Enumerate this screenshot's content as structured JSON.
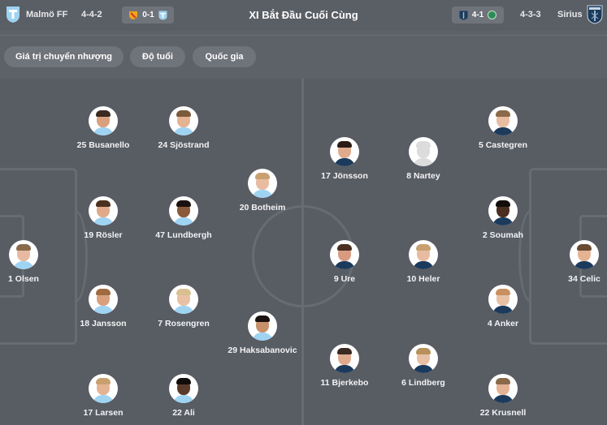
{
  "header": {
    "title": "XI Bắt Đầu Cuối Cùng",
    "home": {
      "name": "Malmö FF",
      "formation": "4-4-2",
      "logo_color": "#9fd3f2",
      "last_result": "0-1"
    },
    "away": {
      "name": "Sirius",
      "formation": "4-3-3",
      "logo_color": "#1b3a5c",
      "last_result": "4-1"
    }
  },
  "filters": [
    "Giá trị chuyển nhượng",
    "Độ tuổi",
    "Quốc gia"
  ],
  "home_players": [
    {
      "label": "1 Olsen",
      "skin": "#e7b9a0",
      "hair": "#8a6a4a",
      "kit": "#9fd3f2"
    },
    {
      "label": "25 Busanello",
      "skin": "#d9a07e",
      "hair": "#3a2a20",
      "kit": "#9fd3f2"
    },
    {
      "label": "24 Sjöstrand",
      "skin": "#e4b394",
      "hair": "#7a5a3a",
      "kit": "#9fd3f2"
    },
    {
      "label": "19 Rösler",
      "skin": "#e0a98a",
      "hair": "#4a3020",
      "kit": "#9fd3f2"
    },
    {
      "label": "47 Lundbergh",
      "skin": "#8a5a3a",
      "hair": "#1a1210",
      "kit": "#9fd3f2"
    },
    {
      "label": "20 Botheim",
      "skin": "#e8bca0",
      "hair": "#c9a070",
      "kit": "#9fd3f2"
    },
    {
      "label": "18 Jansson",
      "skin": "#d9a07e",
      "hair": "#a06a40",
      "kit": "#9fd3f2"
    },
    {
      "label": "7 Rosengren",
      "skin": "#e8c0a4",
      "hair": "#d8c090",
      "kit": "#9fd3f2"
    },
    {
      "label": "29 Haksabanovic",
      "skin": "#c8906a",
      "hair": "#1a1210",
      "kit": "#9fd3f2"
    },
    {
      "label": "17 Larsen",
      "skin": "#e4b394",
      "hair": "#c8a070",
      "kit": "#9fd3f2"
    },
    {
      "label": "22 Ali",
      "skin": "#5a3a2a",
      "hair": "#120c0a",
      "kit": "#9fd3f2"
    }
  ],
  "away_players": [
    {
      "label": "17 Jönsson",
      "skin": "#e0aa8c",
      "hair": "#2a1c14",
      "kit": "#1b3a5c"
    },
    {
      "label": "8 Nartey",
      "skin": "#dcdcdc",
      "hair": "#dcdcdc",
      "kit": "#dcdcdc"
    },
    {
      "label": "5 Castegren",
      "skin": "#e8bca0",
      "hair": "#8a6a4a",
      "kit": "#1b3a5c"
    },
    {
      "label": "2 Soumah",
      "skin": "#4a2e20",
      "hair": "#120c0a",
      "kit": "#1b3a5c"
    },
    {
      "label": "9 Ure",
      "skin": "#d89a80",
      "hair": "#4a3020",
      "kit": "#1b3a5c"
    },
    {
      "label": "10 Heler",
      "skin": "#e8bca0",
      "hair": "#c8a070",
      "kit": "#1b3a5c"
    },
    {
      "label": "34 Celic",
      "skin": "#e4b394",
      "hair": "#6a4a30",
      "kit": "#1b3a5c"
    },
    {
      "label": "4 Anker",
      "skin": "#e8c0a4",
      "hair": "#c89060",
      "kit": "#1b3a5c"
    },
    {
      "label": "11 Bjerkebo",
      "skin": "#e0aa8c",
      "hair": "#3a2a20",
      "kit": "#1b3a5c"
    },
    {
      "label": "6 Lindberg",
      "skin": "#e8c0a4",
      "hair": "#b8905a",
      "kit": "#1b3a5c"
    },
    {
      "label": "22 Krusnell",
      "skin": "#e4b394",
      "hair": "#8a6a4a",
      "kit": "#1b3a5c"
    }
  ]
}
